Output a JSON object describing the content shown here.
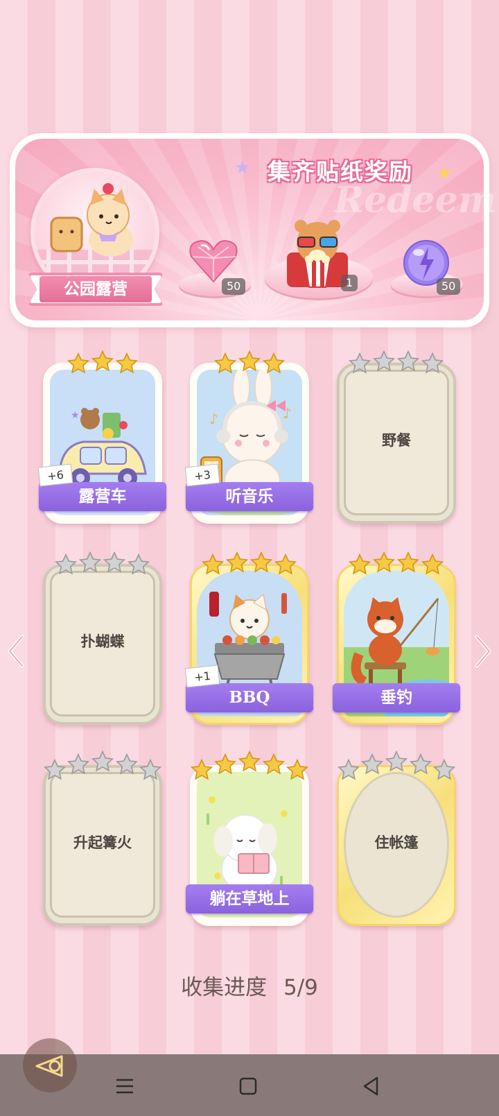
{
  "banner": {
    "title": "集齐贴纸奖励",
    "watermark": "Redeem",
    "album_name": "公园露营",
    "rewards": [
      {
        "icon": "pink-heart-gem-icon",
        "count": "50"
      },
      {
        "icon": "popcorn-bear-icon",
        "count": "1"
      },
      {
        "icon": "purple-energy-orb-icon",
        "count": "50"
      }
    ]
  },
  "cards": [
    {
      "name": "露营车",
      "stars": 3,
      "max_stars": 3,
      "unlocked": true,
      "bonus": "+6",
      "art": "camper-car"
    },
    {
      "name": "听音乐",
      "stars": 3,
      "max_stars": 3,
      "unlocked": true,
      "bonus": "+3",
      "art": "bunny-music"
    },
    {
      "name": "野餐",
      "stars": 0,
      "max_stars": 4,
      "unlocked": false
    },
    {
      "name": "扑蝴蝶",
      "stars": 0,
      "max_stars": 4,
      "unlocked": false
    },
    {
      "name": "BBQ",
      "stars": 4,
      "max_stars": 4,
      "unlocked": true,
      "bonus": "+1",
      "art": "cat-bbq"
    },
    {
      "name": "垂钓",
      "stars": 4,
      "max_stars": 4,
      "unlocked": true,
      "art": "red-panda-fishing"
    },
    {
      "name": "升起篝火",
      "stars": 0,
      "max_stars": 5,
      "unlocked": false
    },
    {
      "name": "躺在草地上",
      "stars": 5,
      "max_stars": 5,
      "unlocked": true,
      "art": "puppy-grass"
    },
    {
      "name": "住帐篷",
      "stars": 0,
      "max_stars": 5,
      "unlocked": false
    }
  ],
  "progress": {
    "label": "收集进度",
    "value": "5/9"
  },
  "colors": {
    "gold_star": "#f7c844",
    "silver_star": "#c8c8c8",
    "label_purple": "#9370e6",
    "banner_pink": "#f5a8bf"
  }
}
